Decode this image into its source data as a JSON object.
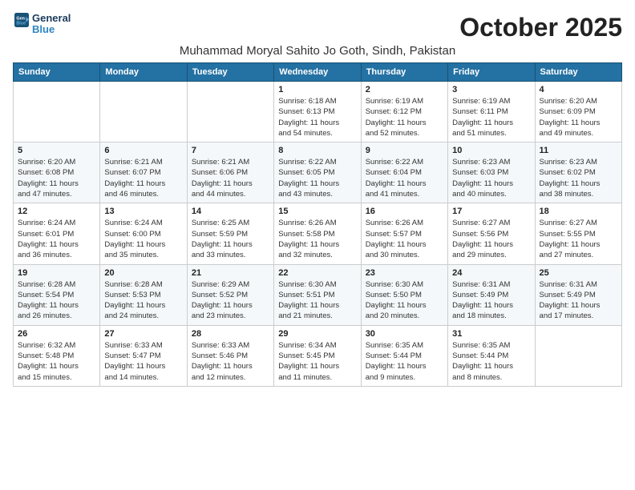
{
  "header": {
    "logo_line1": "General",
    "logo_line2": "Blue",
    "month": "October 2025",
    "location": "Muhammad Moryal Sahito Jo Goth, Sindh, Pakistan"
  },
  "weekdays": [
    "Sunday",
    "Monday",
    "Tuesday",
    "Wednesday",
    "Thursday",
    "Friday",
    "Saturday"
  ],
  "weeks": [
    [
      {
        "day": "",
        "info": ""
      },
      {
        "day": "",
        "info": ""
      },
      {
        "day": "",
        "info": ""
      },
      {
        "day": "1",
        "info": "Sunrise: 6:18 AM\nSunset: 6:13 PM\nDaylight: 11 hours\nand 54 minutes."
      },
      {
        "day": "2",
        "info": "Sunrise: 6:19 AM\nSunset: 6:12 PM\nDaylight: 11 hours\nand 52 minutes."
      },
      {
        "day": "3",
        "info": "Sunrise: 6:19 AM\nSunset: 6:11 PM\nDaylight: 11 hours\nand 51 minutes."
      },
      {
        "day": "4",
        "info": "Sunrise: 6:20 AM\nSunset: 6:09 PM\nDaylight: 11 hours\nand 49 minutes."
      }
    ],
    [
      {
        "day": "5",
        "info": "Sunrise: 6:20 AM\nSunset: 6:08 PM\nDaylight: 11 hours\nand 47 minutes."
      },
      {
        "day": "6",
        "info": "Sunrise: 6:21 AM\nSunset: 6:07 PM\nDaylight: 11 hours\nand 46 minutes."
      },
      {
        "day": "7",
        "info": "Sunrise: 6:21 AM\nSunset: 6:06 PM\nDaylight: 11 hours\nand 44 minutes."
      },
      {
        "day": "8",
        "info": "Sunrise: 6:22 AM\nSunset: 6:05 PM\nDaylight: 11 hours\nand 43 minutes."
      },
      {
        "day": "9",
        "info": "Sunrise: 6:22 AM\nSunset: 6:04 PM\nDaylight: 11 hours\nand 41 minutes."
      },
      {
        "day": "10",
        "info": "Sunrise: 6:23 AM\nSunset: 6:03 PM\nDaylight: 11 hours\nand 40 minutes."
      },
      {
        "day": "11",
        "info": "Sunrise: 6:23 AM\nSunset: 6:02 PM\nDaylight: 11 hours\nand 38 minutes."
      }
    ],
    [
      {
        "day": "12",
        "info": "Sunrise: 6:24 AM\nSunset: 6:01 PM\nDaylight: 11 hours\nand 36 minutes."
      },
      {
        "day": "13",
        "info": "Sunrise: 6:24 AM\nSunset: 6:00 PM\nDaylight: 11 hours\nand 35 minutes."
      },
      {
        "day": "14",
        "info": "Sunrise: 6:25 AM\nSunset: 5:59 PM\nDaylight: 11 hours\nand 33 minutes."
      },
      {
        "day": "15",
        "info": "Sunrise: 6:26 AM\nSunset: 5:58 PM\nDaylight: 11 hours\nand 32 minutes."
      },
      {
        "day": "16",
        "info": "Sunrise: 6:26 AM\nSunset: 5:57 PM\nDaylight: 11 hours\nand 30 minutes."
      },
      {
        "day": "17",
        "info": "Sunrise: 6:27 AM\nSunset: 5:56 PM\nDaylight: 11 hours\nand 29 minutes."
      },
      {
        "day": "18",
        "info": "Sunrise: 6:27 AM\nSunset: 5:55 PM\nDaylight: 11 hours\nand 27 minutes."
      }
    ],
    [
      {
        "day": "19",
        "info": "Sunrise: 6:28 AM\nSunset: 5:54 PM\nDaylight: 11 hours\nand 26 minutes."
      },
      {
        "day": "20",
        "info": "Sunrise: 6:28 AM\nSunset: 5:53 PM\nDaylight: 11 hours\nand 24 minutes."
      },
      {
        "day": "21",
        "info": "Sunrise: 6:29 AM\nSunset: 5:52 PM\nDaylight: 11 hours\nand 23 minutes."
      },
      {
        "day": "22",
        "info": "Sunrise: 6:30 AM\nSunset: 5:51 PM\nDaylight: 11 hours\nand 21 minutes."
      },
      {
        "day": "23",
        "info": "Sunrise: 6:30 AM\nSunset: 5:50 PM\nDaylight: 11 hours\nand 20 minutes."
      },
      {
        "day": "24",
        "info": "Sunrise: 6:31 AM\nSunset: 5:49 PM\nDaylight: 11 hours\nand 18 minutes."
      },
      {
        "day": "25",
        "info": "Sunrise: 6:31 AM\nSunset: 5:49 PM\nDaylight: 11 hours\nand 17 minutes."
      }
    ],
    [
      {
        "day": "26",
        "info": "Sunrise: 6:32 AM\nSunset: 5:48 PM\nDaylight: 11 hours\nand 15 minutes."
      },
      {
        "day": "27",
        "info": "Sunrise: 6:33 AM\nSunset: 5:47 PM\nDaylight: 11 hours\nand 14 minutes."
      },
      {
        "day": "28",
        "info": "Sunrise: 6:33 AM\nSunset: 5:46 PM\nDaylight: 11 hours\nand 12 minutes."
      },
      {
        "day": "29",
        "info": "Sunrise: 6:34 AM\nSunset: 5:45 PM\nDaylight: 11 hours\nand 11 minutes."
      },
      {
        "day": "30",
        "info": "Sunrise: 6:35 AM\nSunset: 5:44 PM\nDaylight: 11 hours\nand 9 minutes."
      },
      {
        "day": "31",
        "info": "Sunrise: 6:35 AM\nSunset: 5:44 PM\nDaylight: 11 hours\nand 8 minutes."
      },
      {
        "day": "",
        "info": ""
      }
    ]
  ]
}
